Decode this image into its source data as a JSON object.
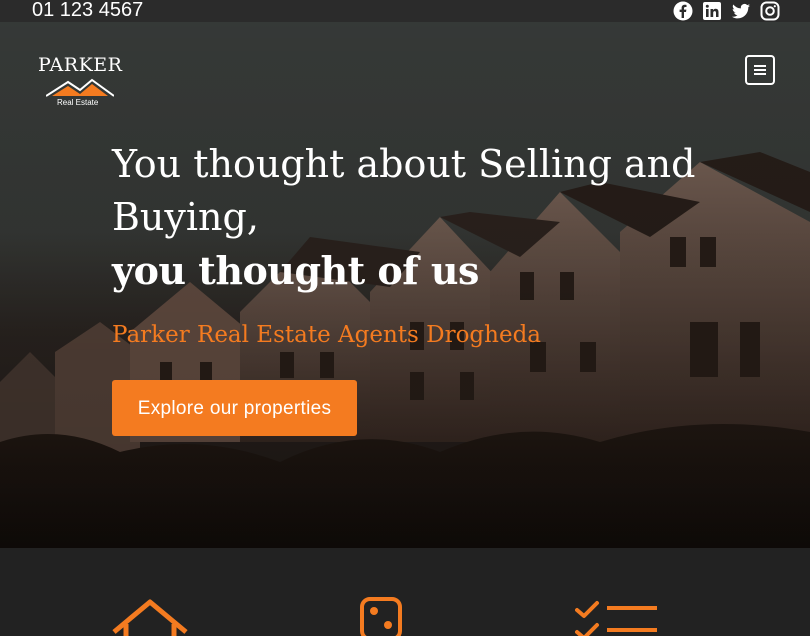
{
  "topbar": {
    "phone": "01 123 4567",
    "socials": [
      {
        "icon": "facebook-icon"
      },
      {
        "icon": "linkedin-icon"
      },
      {
        "icon": "twitter-icon"
      },
      {
        "icon": "instagram-icon"
      }
    ]
  },
  "logo": {
    "name": "PARKER",
    "sub": "Real Estate"
  },
  "hero": {
    "headline_line1": "You thought about Selling and Buying,",
    "headline_line2": "you thought of us",
    "subheading": "Parker Real Estate Agents Drogheda",
    "cta_label": "Explore our properties"
  },
  "features": {
    "icons": [
      "house-icon",
      "dice-icon",
      "checklist-icon"
    ]
  },
  "colors": {
    "accent": "#f47b20",
    "topbar": "#2b2b2b",
    "footer_bg": "#222222"
  }
}
